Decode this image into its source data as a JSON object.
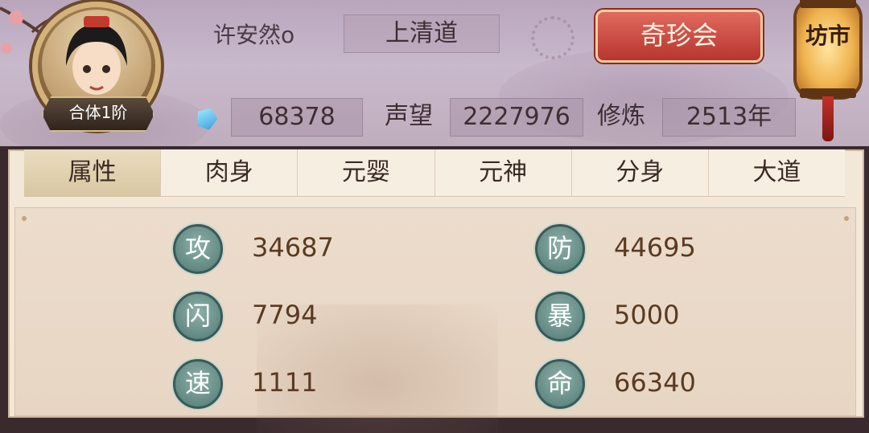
{
  "header": {
    "player_name": "许安然o",
    "sect": "上清道",
    "rank": "合体1阶",
    "treasure_button": "奇珍会",
    "market_lantern": "坊市",
    "spirit_stones": "68378",
    "reputation_label": "声望",
    "reputation_value": "2227976",
    "cultivation_label": "修炼",
    "cultivation_value": "2513年"
  },
  "tabs": [
    {
      "label": "属性",
      "active": true
    },
    {
      "label": "肉身",
      "active": false
    },
    {
      "label": "元婴",
      "active": false
    },
    {
      "label": "元神",
      "active": false
    },
    {
      "label": "分身",
      "active": false
    },
    {
      "label": "大道",
      "active": false
    }
  ],
  "attributes": [
    {
      "icon": "攻",
      "value": "34687"
    },
    {
      "icon": "防",
      "value": "44695"
    },
    {
      "icon": "闪",
      "value": "7794"
    },
    {
      "icon": "暴",
      "value": "5000"
    },
    {
      "icon": "速",
      "value": "1111"
    },
    {
      "icon": "命",
      "value": "66340"
    }
  ],
  "colors": {
    "accent_red": "#b8352e",
    "icon_teal": "#4f7a74",
    "value_brown": "#5a3a22"
  }
}
